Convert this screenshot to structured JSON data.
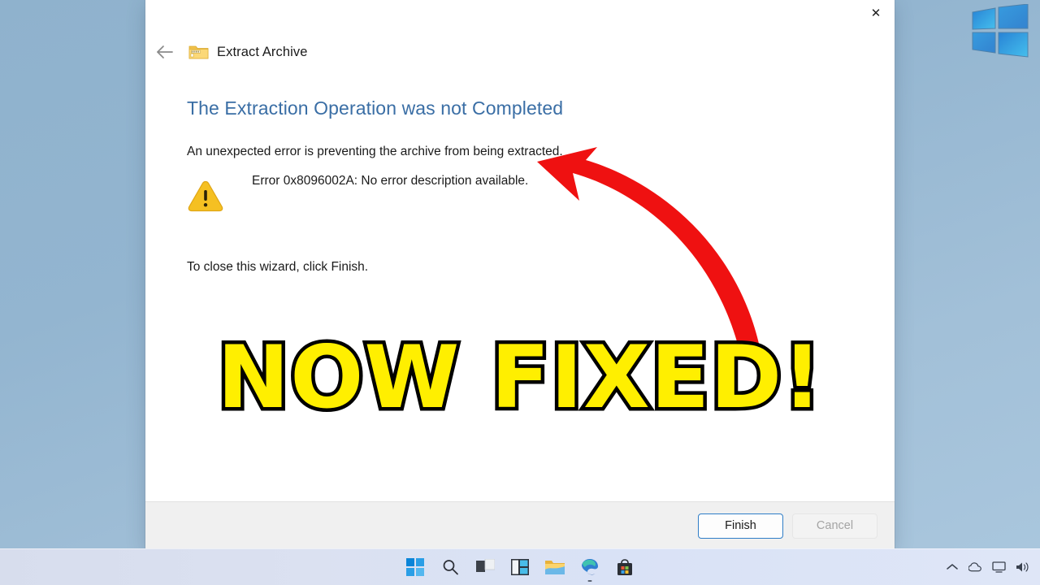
{
  "desktop": {
    "background_color_top": "#8fb2cd",
    "background_color_bottom": "#aac7de",
    "watermark_name": "windows-logo-watermark"
  },
  "dialog": {
    "close_label": "✕",
    "header": {
      "back_label": "←",
      "archive_icon_name": "zip-folder-icon",
      "title": "Extract Archive"
    },
    "heading": "The Extraction Operation was not Completed",
    "heading_color": "#3a6ea5",
    "sub_message": "An unexpected error is preventing the archive from being extracted.",
    "error": {
      "icon_name": "warning-triangle-icon",
      "icon_color": "#f5c022",
      "text": "Error 0x8096002A: No error description available.",
      "code": "0x8096002A"
    },
    "close_hint": "To close this wizard, click Finish.",
    "footer": {
      "finish_label": "Finish",
      "finish_accent_color": "#2f7dc7",
      "cancel_label": "Cancel",
      "cancel_disabled": true
    }
  },
  "annotations": {
    "arrow_name": "red-curved-arrow",
    "arrow_color": "#ef1111",
    "overlay_text": "NOW FIXED!",
    "overlay_fill_color": "#ffef00",
    "overlay_stroke_color": "#000000"
  },
  "taskbar": {
    "background_color": "#dce3f2",
    "items": [
      {
        "name": "start-button",
        "label": "Start"
      },
      {
        "name": "search-icon",
        "label": "Search"
      },
      {
        "name": "task-view-icon",
        "label": "Task View"
      },
      {
        "name": "widgets-icon",
        "label": "Widgets"
      },
      {
        "name": "file-explorer-icon",
        "label": "File Explorer"
      },
      {
        "name": "edge-browser-icon",
        "label": "Microsoft Edge"
      },
      {
        "name": "microsoft-store-icon",
        "label": "Microsoft Store"
      }
    ],
    "tray": [
      {
        "name": "show-hidden-icons-icon",
        "label": "Show hidden icons"
      },
      {
        "name": "onedrive-cloud-icon",
        "label": "OneDrive"
      },
      {
        "name": "network-icon",
        "label": "Network"
      },
      {
        "name": "volume-icon",
        "label": "Volume"
      }
    ]
  }
}
